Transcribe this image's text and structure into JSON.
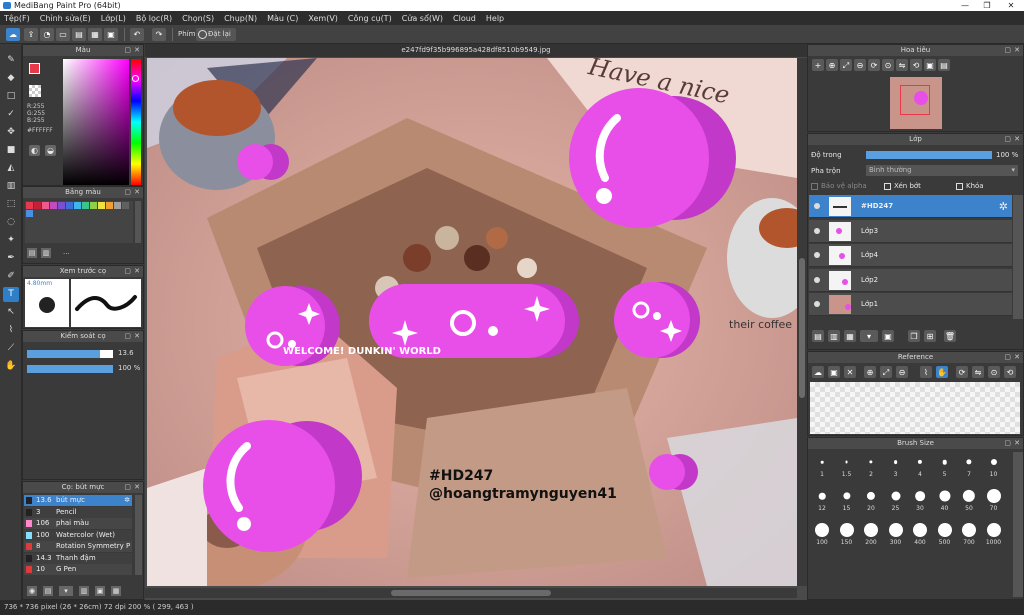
{
  "window": {
    "title": "MediBang Paint Pro (64bit)",
    "minimize": "—",
    "restore": "❐",
    "close": "✕"
  },
  "menu": [
    "Tệp(F)",
    "Chỉnh sửa(E)",
    "Lớp(L)",
    "Bộ lọc(R)",
    "Chọn(S)",
    "Chụp(N)",
    "Màu (C)",
    "Xem(V)",
    "Công cụ(T)",
    "Cửa sổ(W)",
    "Cloud",
    "Help"
  ],
  "toolbar": {
    "snap_label": "Phím",
    "reset_label": "Đặt lại"
  },
  "file_tab": "e247fd9f35b996895a428df8510b9549.jpg",
  "color_panel": {
    "title": "Màu",
    "r": "R:255",
    "g": "G:255",
    "b": "B:255",
    "hex": "#FFFFFF"
  },
  "palette_panel": {
    "title": "Bảng màu",
    "more": "..."
  },
  "preview_panel": {
    "title": "Xem trước cọ",
    "size": "4.80mm"
  },
  "control_panel": {
    "title": "Kiểm soát cọ",
    "size_value": "13.6",
    "opacity_value": "100 %",
    "size_fraction": 0.85,
    "opacity_fraction": 1.0
  },
  "brush_panel": {
    "title": "Cọ: bút mực",
    "items": [
      {
        "size": "13.6",
        "name": "bút mực",
        "color": "#222222",
        "selected": true
      },
      {
        "size": "3",
        "name": "Pencil",
        "color": "#222222"
      },
      {
        "size": "106",
        "name": "phai màu",
        "color": "#ff88cc"
      },
      {
        "size": "100",
        "name": "Watercolor (Wet)",
        "color": "#88ddff"
      },
      {
        "size": "8",
        "name": "Rotation Symmetry Pe",
        "color": "#e03a3a"
      },
      {
        "size": "14.3",
        "name": "Thanh đậm",
        "color": "#222222"
      },
      {
        "size": "10",
        "name": "G Pen",
        "color": "#e03a3a"
      }
    ]
  },
  "navigator_panel": {
    "title": "Hoa tiêu"
  },
  "layer_panel": {
    "title": "Lớp",
    "opacity_label": "Độ trong",
    "opacity_value": "100 %",
    "opacity_fraction": 1.0,
    "blend_label": "Pha trộn",
    "blend_value": "Bình thường",
    "protect_alpha": "Bảo vệ alpha",
    "clipping": "Xén bớt",
    "lock": "Khóa",
    "layers": [
      {
        "name": "#HD247",
        "selected": true
      },
      {
        "name": "Lớp3"
      },
      {
        "name": "Lớp4"
      },
      {
        "name": "Lớp2"
      },
      {
        "name": "Lớp1"
      }
    ]
  },
  "reference_panel": {
    "title": "Reference"
  },
  "brush_size_panel": {
    "title": "Brush Size",
    "sizes": [
      "1",
      "1.5",
      "2",
      "3",
      "4",
      "5",
      "7",
      "10",
      "12",
      "15",
      "20",
      "25",
      "30",
      "40",
      "50",
      "70",
      "100",
      "150",
      "200",
      "300",
      "400",
      "500",
      "700",
      "1000"
    ]
  },
  "canvas": {
    "watermark_line1": "#HD247",
    "watermark_line2": "@hoangtramynguyen41",
    "sticker_text": "WELCOME! DUNKIN' WORLD",
    "cup_text": "their coffee"
  },
  "status": "736 * 736 pixel   (26 * 26cm)   72 dpi   200 %   ( 299, 463 )",
  "colors": {
    "accent": "#3d83cc",
    "magenta": "#e84fe8",
    "magenta_dark": "#c238c9"
  }
}
